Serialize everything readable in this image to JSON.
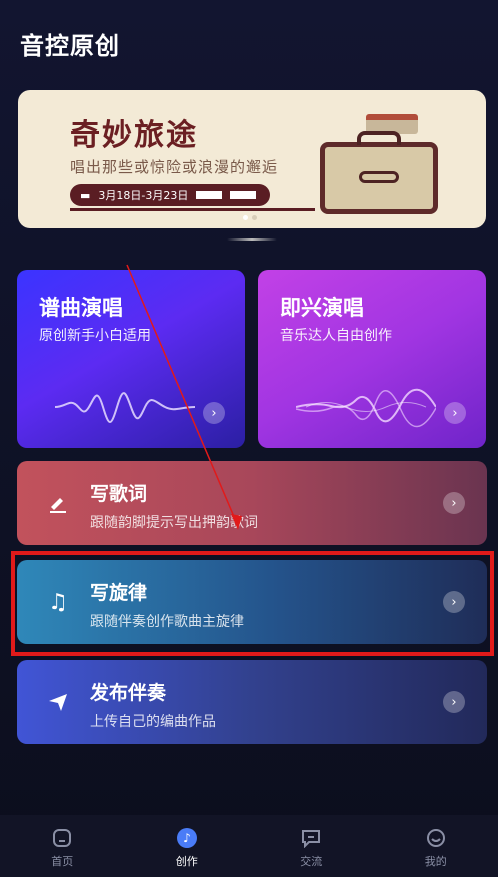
{
  "header": {
    "title": "音控原创"
  },
  "banner": {
    "title": "奇妙旅途",
    "subtitle": "唱出那些或惊险或浪漫的邂逅",
    "date_range": "3月18日-3月23日"
  },
  "cards": [
    {
      "title": "谱曲演唱",
      "subtitle": "原创新手小白适用",
      "icon": "waveform-icon",
      "color": "#3b34ff"
    },
    {
      "title": "即兴演唱",
      "subtitle": "音乐达人自由创作",
      "icon": "soundwave-icon",
      "color": "#b53ee4"
    }
  ],
  "rows": [
    {
      "title": "写歌词",
      "subtitle": "跟随韵脚提示写出押韵歌词",
      "icon": "pen-icon",
      "color": "#c2525c"
    },
    {
      "title": "写旋律",
      "subtitle": "跟随伴奏创作歌曲主旋律",
      "icon": "music-note-icon",
      "color": "#2f88b9"
    },
    {
      "title": "发布伴奏",
      "subtitle": "上传自己的编曲作品",
      "icon": "send-icon",
      "color": "#4155d6"
    }
  ],
  "tabbar": {
    "items": [
      {
        "label": "首页",
        "icon": "home-icon"
      },
      {
        "label": "创作",
        "icon": "music-note-icon",
        "active": true
      },
      {
        "label": "交流",
        "icon": "chat-icon"
      },
      {
        "label": "我的",
        "icon": "profile-icon"
      }
    ]
  },
  "annotation": {
    "highlight_color": "#e11a1a"
  }
}
